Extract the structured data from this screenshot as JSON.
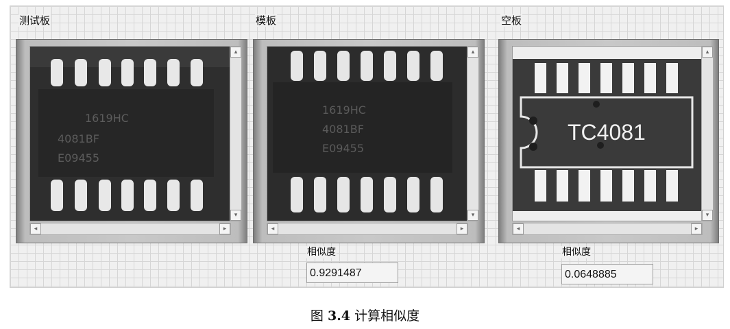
{
  "views": [
    {
      "label": "测试板",
      "chip_marking": [
        "1619HC",
        "4081BF",
        "E09455"
      ]
    },
    {
      "label": "模板",
      "chip_marking": [
        "1619HC",
        "4081BF",
        "E09455"
      ]
    },
    {
      "label": "空板",
      "silkscreen": "TC4081"
    }
  ],
  "indicators": [
    {
      "label": "相似度",
      "value": "0.9291487"
    },
    {
      "label": "相似度",
      "value": "0.0648885"
    }
  ],
  "caption": {
    "prefix": "图 ",
    "number": "3.4",
    "text": " 计算相似度"
  },
  "scroll_glyphs": {
    "up": "▴",
    "down": "▾",
    "left": "◂",
    "right": "▸"
  }
}
